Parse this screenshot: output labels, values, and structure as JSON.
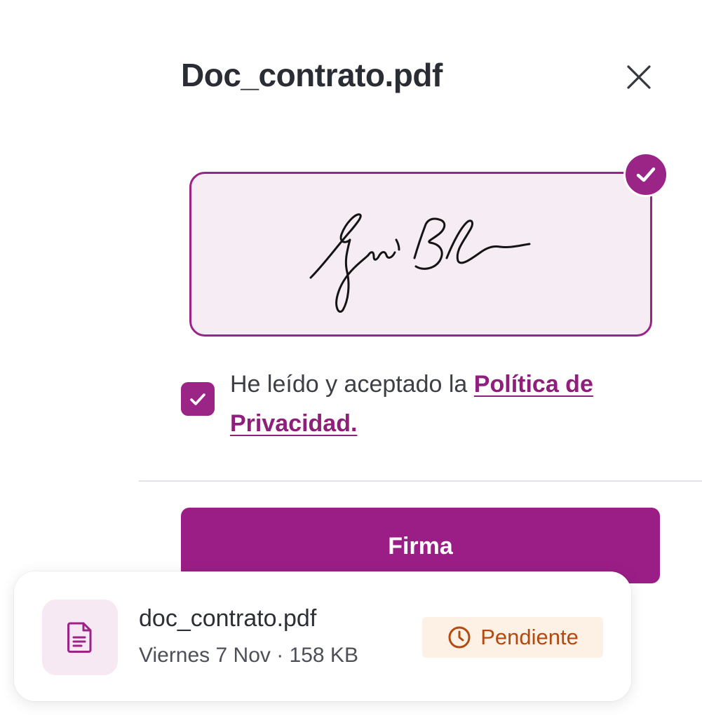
{
  "dialog": {
    "title": "Doc_contrato.pdf",
    "close_icon": "close-icon"
  },
  "signature": {
    "captured": true,
    "check_icon": "check-circle-icon"
  },
  "consent": {
    "checked": true,
    "text": "He leído y aceptado la ",
    "link_text": "Política de Privacidad."
  },
  "actions": {
    "sign_label": "Firma"
  },
  "file_card": {
    "file_name": "doc_contrato.pdf",
    "meta": "Viernes 7 Nov · 158 KB",
    "status": "Pendiente",
    "status_icon": "clock-icon",
    "file_icon": "document-icon"
  },
  "colors": {
    "accent": "#9b1e87",
    "signature_bg": "#f6ecf4",
    "status_bg": "#fdf0e4",
    "status_text": "#b24a12"
  }
}
